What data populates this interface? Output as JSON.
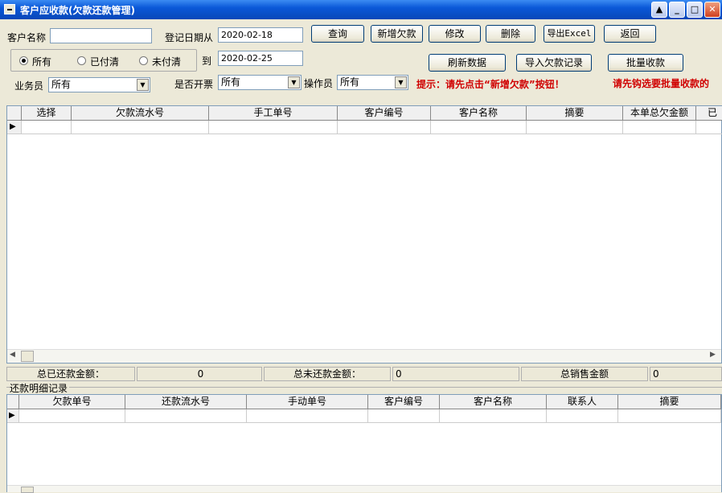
{
  "window": {
    "title": "客户应收款(欠款还款管理)"
  },
  "filters": {
    "customer_name_label": "客户名称",
    "customer_name_value": "",
    "reg_date_from_label": "登记日期从",
    "date_from": "2020-02-18",
    "to_label": "到",
    "date_to": "2020-02-25",
    "status_options": [
      "所有",
      "已付清",
      "未付清"
    ],
    "status_selected": "所有",
    "salesman_label": "业务员",
    "salesman_value": "所有",
    "invoice_label": "是否开票",
    "invoice_value": "所有",
    "operator_label": "操作员",
    "operator_value": "所有"
  },
  "buttons": {
    "query": "查询",
    "new_debt": "新增欠款",
    "modify": "修改",
    "delete": "删除",
    "export_excel": "导出Excel",
    "back": "返回",
    "refresh": "刷新数据",
    "import": "导入欠款记录",
    "batch": "批量收款"
  },
  "hints": {
    "tip": "提示：请先点击“新增欠款”按钮！",
    "batch_tip": "请先钩选要批量收款的"
  },
  "main_table": {
    "columns": [
      "选择",
      "欠款流水号",
      "手工单号",
      "客户编号",
      "客户名称",
      "摘要",
      "本单总欠金额",
      "已"
    ]
  },
  "summary": {
    "paid_label": "总已还款金额：",
    "paid_value": "0",
    "unpaid_label": "总未还款金额：",
    "unpaid_value": "0",
    "sales_label": "总销售金额",
    "sales_value": "0"
  },
  "detail": {
    "title": "还款明细记录",
    "columns": [
      "欠款单号",
      "还款流水号",
      "手动单号",
      "客户编号",
      "客户名称",
      "联系人",
      "摘要"
    ]
  }
}
